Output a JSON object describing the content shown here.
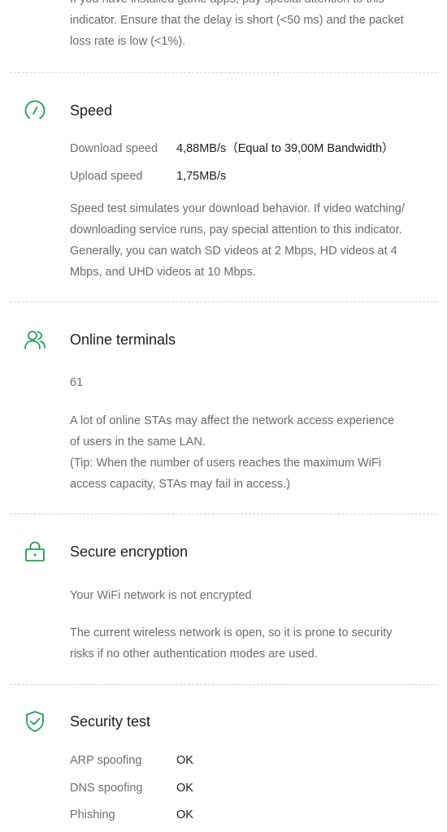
{
  "intro": {
    "line1": "If you have installed game apps, pay special attention to this",
    "line2": "indicator. Ensure that the delay is short (<50 ms) and the packet",
    "line3": "loss rate is low (<1%)."
  },
  "speed": {
    "icon": "speedometer-icon",
    "title": "Speed",
    "download_label": "Download speed",
    "download_value": "4,88MB/s（Equal to 39,00M Bandwidth）",
    "upload_label": "Upload speed",
    "upload_value": "1,75MB/s",
    "desc": [
      "Speed test simulates your download behavior. If video watching/",
      "downloading service runs, pay special attention to this indicator.",
      "Generally, you can watch SD videos at 2 Mbps, HD videos at 4",
      "Mbps, and UHD videos at 10 Mbps."
    ]
  },
  "terminals": {
    "icon": "users-icon",
    "title": "Online terminals",
    "count": "61",
    "desc": [
      "A lot of online STAs may affect the network access experience",
      "of users in the same LAN.",
      "(Tip: When the number of users reaches the maximum WiFi",
      "access capacity, STAs may fail in access.)"
    ]
  },
  "encryption": {
    "icon": "lock-icon",
    "title": "Secure encryption",
    "status": "Your WiFi network is not encrypted",
    "desc": [
      "The current wireless network is open, so it is prone to security",
      "risks if no other authentication modes are used."
    ]
  },
  "security": {
    "icon": "shield-check-icon",
    "title": "Security test",
    "items": [
      {
        "label": "ARP spoofing",
        "value": "OK"
      },
      {
        "label": "DNS spoofing",
        "value": "OK"
      },
      {
        "label": "Phishing",
        "value": "OK"
      }
    ]
  },
  "colors": {
    "accent": "#1fa055",
    "text_primary": "#202020",
    "text_secondary": "#6b6b6b"
  }
}
